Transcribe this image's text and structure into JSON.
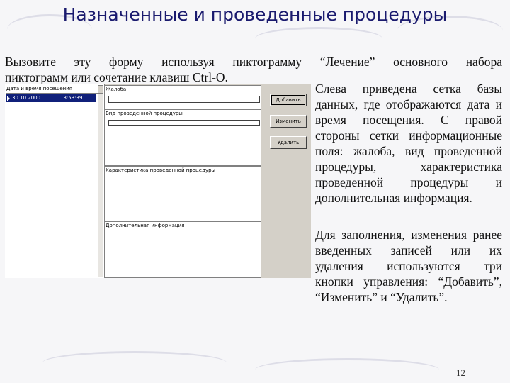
{
  "slide": {
    "title": "Назначенные и проведенные процедуры",
    "intro_line1": "Вызовите эту форму используя пиктограмму “Лечение” основного набора",
    "intro_line2": "пиктограмм или сочетание клавиш Ctrl-O.",
    "paragraph1": "Слева приведена сетка базы данных, где отображаются дата и время посещения. С правой стороны сетки информационные поля: жалоба, вид проведенной процедуры, характеристика проведенной процедуры и дополнительная информация.",
    "paragraph2": "Для заполнения, изменения ранее введенных записей или их удаления используются три кнопки управления: “Добавить”, “Изменить” и “Удалить”.",
    "page_number": "12"
  },
  "form": {
    "grid_header": "Дата и время посещения",
    "rows": [
      {
        "date": "30.10.2000",
        "time": "13:53:39"
      }
    ],
    "labels": {
      "complaint": "Жалоба",
      "procedure_type": "Вид проведенной процедуры",
      "procedure_char": "Характеристика проведенной процедуры",
      "additional": "Дополнительная информация"
    },
    "buttons": {
      "add": "Добавить",
      "edit": "Изменить",
      "delete": "Удалить"
    }
  }
}
